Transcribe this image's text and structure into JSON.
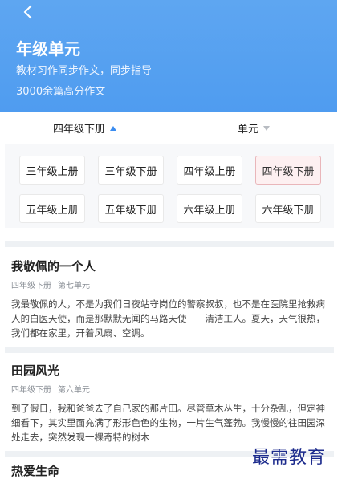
{
  "header": {
    "title": "年级单元",
    "subtitle_1": "教材习作同步作文，同步指导",
    "subtitle_2": "3000余篇高分作文",
    "background_color": "#4f9cf0",
    "back_icon": "chevron-left-icon"
  },
  "filters": {
    "grade_label": "四年级下册",
    "grade_icon": "caret-up-icon",
    "unit_label": "单元",
    "unit_icon": "caret-down-icon",
    "accent_color": "#3a8cf0"
  },
  "grades": [
    {
      "label": "三年级上册",
      "active": false
    },
    {
      "label": "三年级下册",
      "active": false
    },
    {
      "label": "四年级上册",
      "active": false
    },
    {
      "label": "四年级下册",
      "active": true
    },
    {
      "label": "五年级上册",
      "active": false
    },
    {
      "label": "五年级下册",
      "active": false
    },
    {
      "label": "六年级上册",
      "active": false
    },
    {
      "label": "六年级下册",
      "active": false
    }
  ],
  "articles": [
    {
      "title": "我敬佩的一个人",
      "grade": "四年级下册",
      "unit": "第七单元",
      "excerpt": "我最敬佩的人，不是为我们日夜站守岗位的警察叔叔，也不是在医院里抢救病人的白医天使，而是那默默无闻的马路天使——清洁工人。夏天，天气很热，我们都在家里，开着风扇、空调。"
    },
    {
      "title": "田园风光",
      "grade": "四年级下册",
      "unit": "第六单元",
      "excerpt": "到了假日，我和爸爸去了自己家的那片田。尽管草木丛生，十分杂乱，但定神细看下，其实里面充满了形形色色的生物，一片生气蓬勃。我慢慢的往田园深处走去，突然发现一棵奇特的树木"
    },
    {
      "title": "热爱生命",
      "grade": "",
      "unit": "",
      "excerpt": ""
    }
  ],
  "watermark": "最需教育"
}
